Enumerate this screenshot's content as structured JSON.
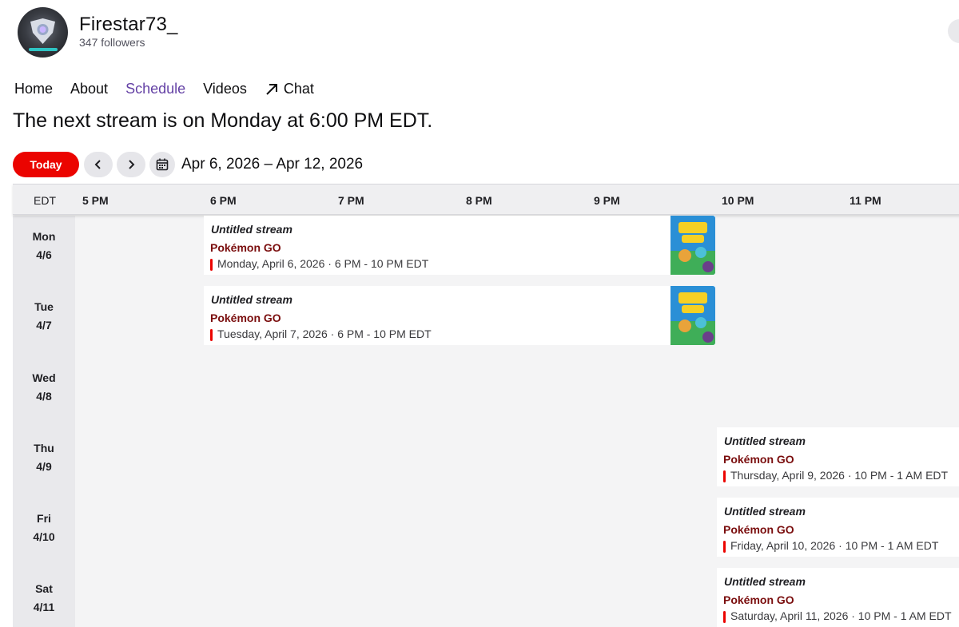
{
  "channel": {
    "name": "Firestar73_",
    "followers": "347 followers"
  },
  "nav": {
    "tabs": [
      {
        "label": "Home"
      },
      {
        "label": "About"
      },
      {
        "label": "Schedule"
      },
      {
        "label": "Videos"
      },
      {
        "label": "Chat"
      }
    ],
    "active": "Schedule"
  },
  "next_stream": "The next stream is on Monday at 6:00 PM EDT.",
  "controls": {
    "today_label": "Today",
    "date_range": "Apr 6, 2026 – Apr 12, 2026"
  },
  "grid": {
    "timezone": "EDT",
    "hours": [
      "5 PM",
      "6 PM",
      "7 PM",
      "8 PM",
      "9 PM",
      "10 PM",
      "11 PM"
    ],
    "days": [
      {
        "dow": "Mon",
        "date": "4/6"
      },
      {
        "dow": "Tue",
        "date": "4/7"
      },
      {
        "dow": "Wed",
        "date": "4/8"
      },
      {
        "dow": "Thu",
        "date": "4/9"
      },
      {
        "dow": "Fri",
        "date": "4/10"
      },
      {
        "dow": "Sat",
        "date": "4/11"
      }
    ]
  },
  "streams": [
    {
      "title": "Untitled stream",
      "game": "Pokémon GO",
      "time": "Monday, April 6, 2026 · 6 PM - 10 PM EDT",
      "thumbnail_icon": "pokemon-go-box-art"
    },
    {
      "title": "Untitled stream",
      "game": "Pokémon GO",
      "time": "Tuesday, April 7, 2026 · 6 PM - 10 PM EDT",
      "thumbnail_icon": "pokemon-go-box-art"
    },
    {
      "title": "Untitled stream",
      "game": "Pokémon GO",
      "time": "Thursday, April 9, 2026 · 10 PM - 1 AM EDT"
    },
    {
      "title": "Untitled stream",
      "game": "Pokémon GO",
      "time": "Friday, April 10, 2026 · 10 PM - 1 AM EDT"
    },
    {
      "title": "Untitled stream",
      "game": "Pokémon GO",
      "time": "Saturday, April 11, 2026 · 10 PM - 1 AM EDT"
    }
  ],
  "colors": {
    "accent": "#6441a5",
    "today": "#eb0400",
    "game_text": "#7a0d0d"
  }
}
